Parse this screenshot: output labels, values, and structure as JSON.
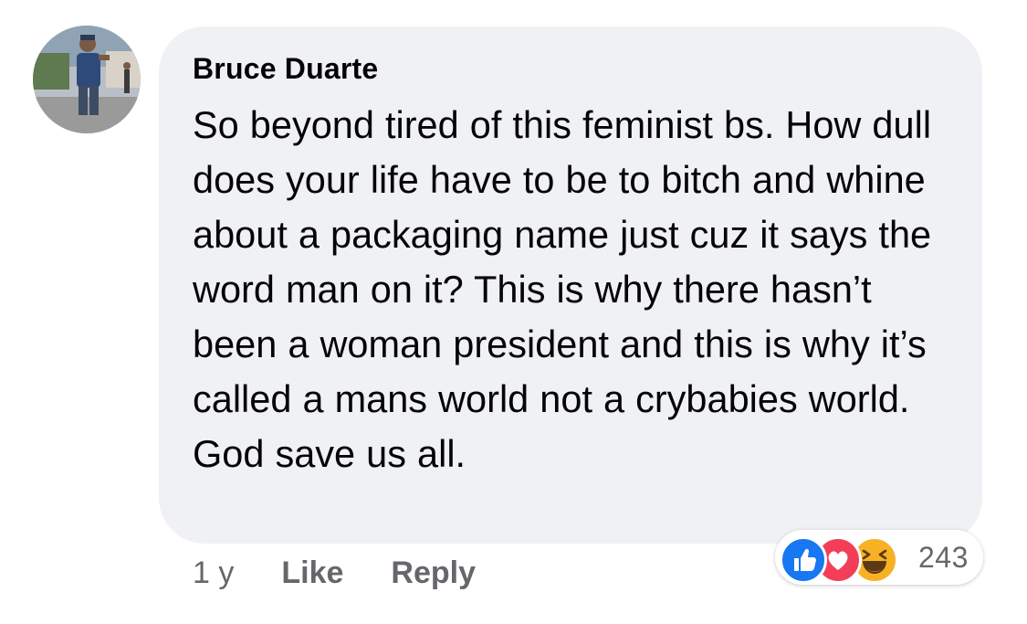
{
  "comment": {
    "author": "Bruce Duarte",
    "text": "So beyond tired of this feminist bs. How dull does your life have to be to bitch and whine about a packaging name just cuz it says the word man on it? This is why there hasn’t been a woman president and this is why it’s called a mans world not a crybabies world. God save us all.",
    "age": "1 y",
    "like_label": "Like",
    "reply_label": "Reply"
  },
  "reactions": {
    "icons": [
      "like-icon",
      "love-icon",
      "haha-icon"
    ],
    "count": "243"
  },
  "colors": {
    "bubble_bg": "#f0f1f4",
    "like_blue": "#1877f2",
    "love_red": "#f33e58",
    "haha_yellow": "#f7b125",
    "meta_gray": "#65676b"
  }
}
